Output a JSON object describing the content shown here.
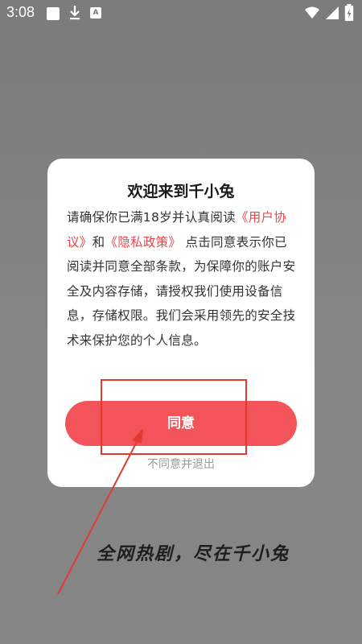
{
  "status_bar": {
    "time": "3:08",
    "icons": [
      "notification-box-icon",
      "download-icon",
      "a-badge-icon",
      "wifi-icon",
      "signal-icon",
      "battery-charging-icon"
    ],
    "a_badge_text": "A"
  },
  "dialog": {
    "title": "欢迎来到千小兔",
    "body_prefix": "请确保你已满18岁并认真阅读",
    "user_agreement_link": "《用户协议》",
    "and_text": "和",
    "privacy_policy_link": "《隐私政策》",
    "body_suffix": " 点击同意表示你已阅读并同意全部条款，为保障你的账户安全及内容存储，请授权我们使用设备信息，存储权限。我们会采用领先的安全技术来保护您的个人信息。",
    "agree_button": "同意",
    "disagree_link": "不同意并退出"
  },
  "slogan": "全网热剧，尽在千小兔",
  "colors": {
    "accent": "#f25459",
    "link": "#e8474f",
    "annotation": "#e23a30",
    "backdrop": "#808080"
  }
}
